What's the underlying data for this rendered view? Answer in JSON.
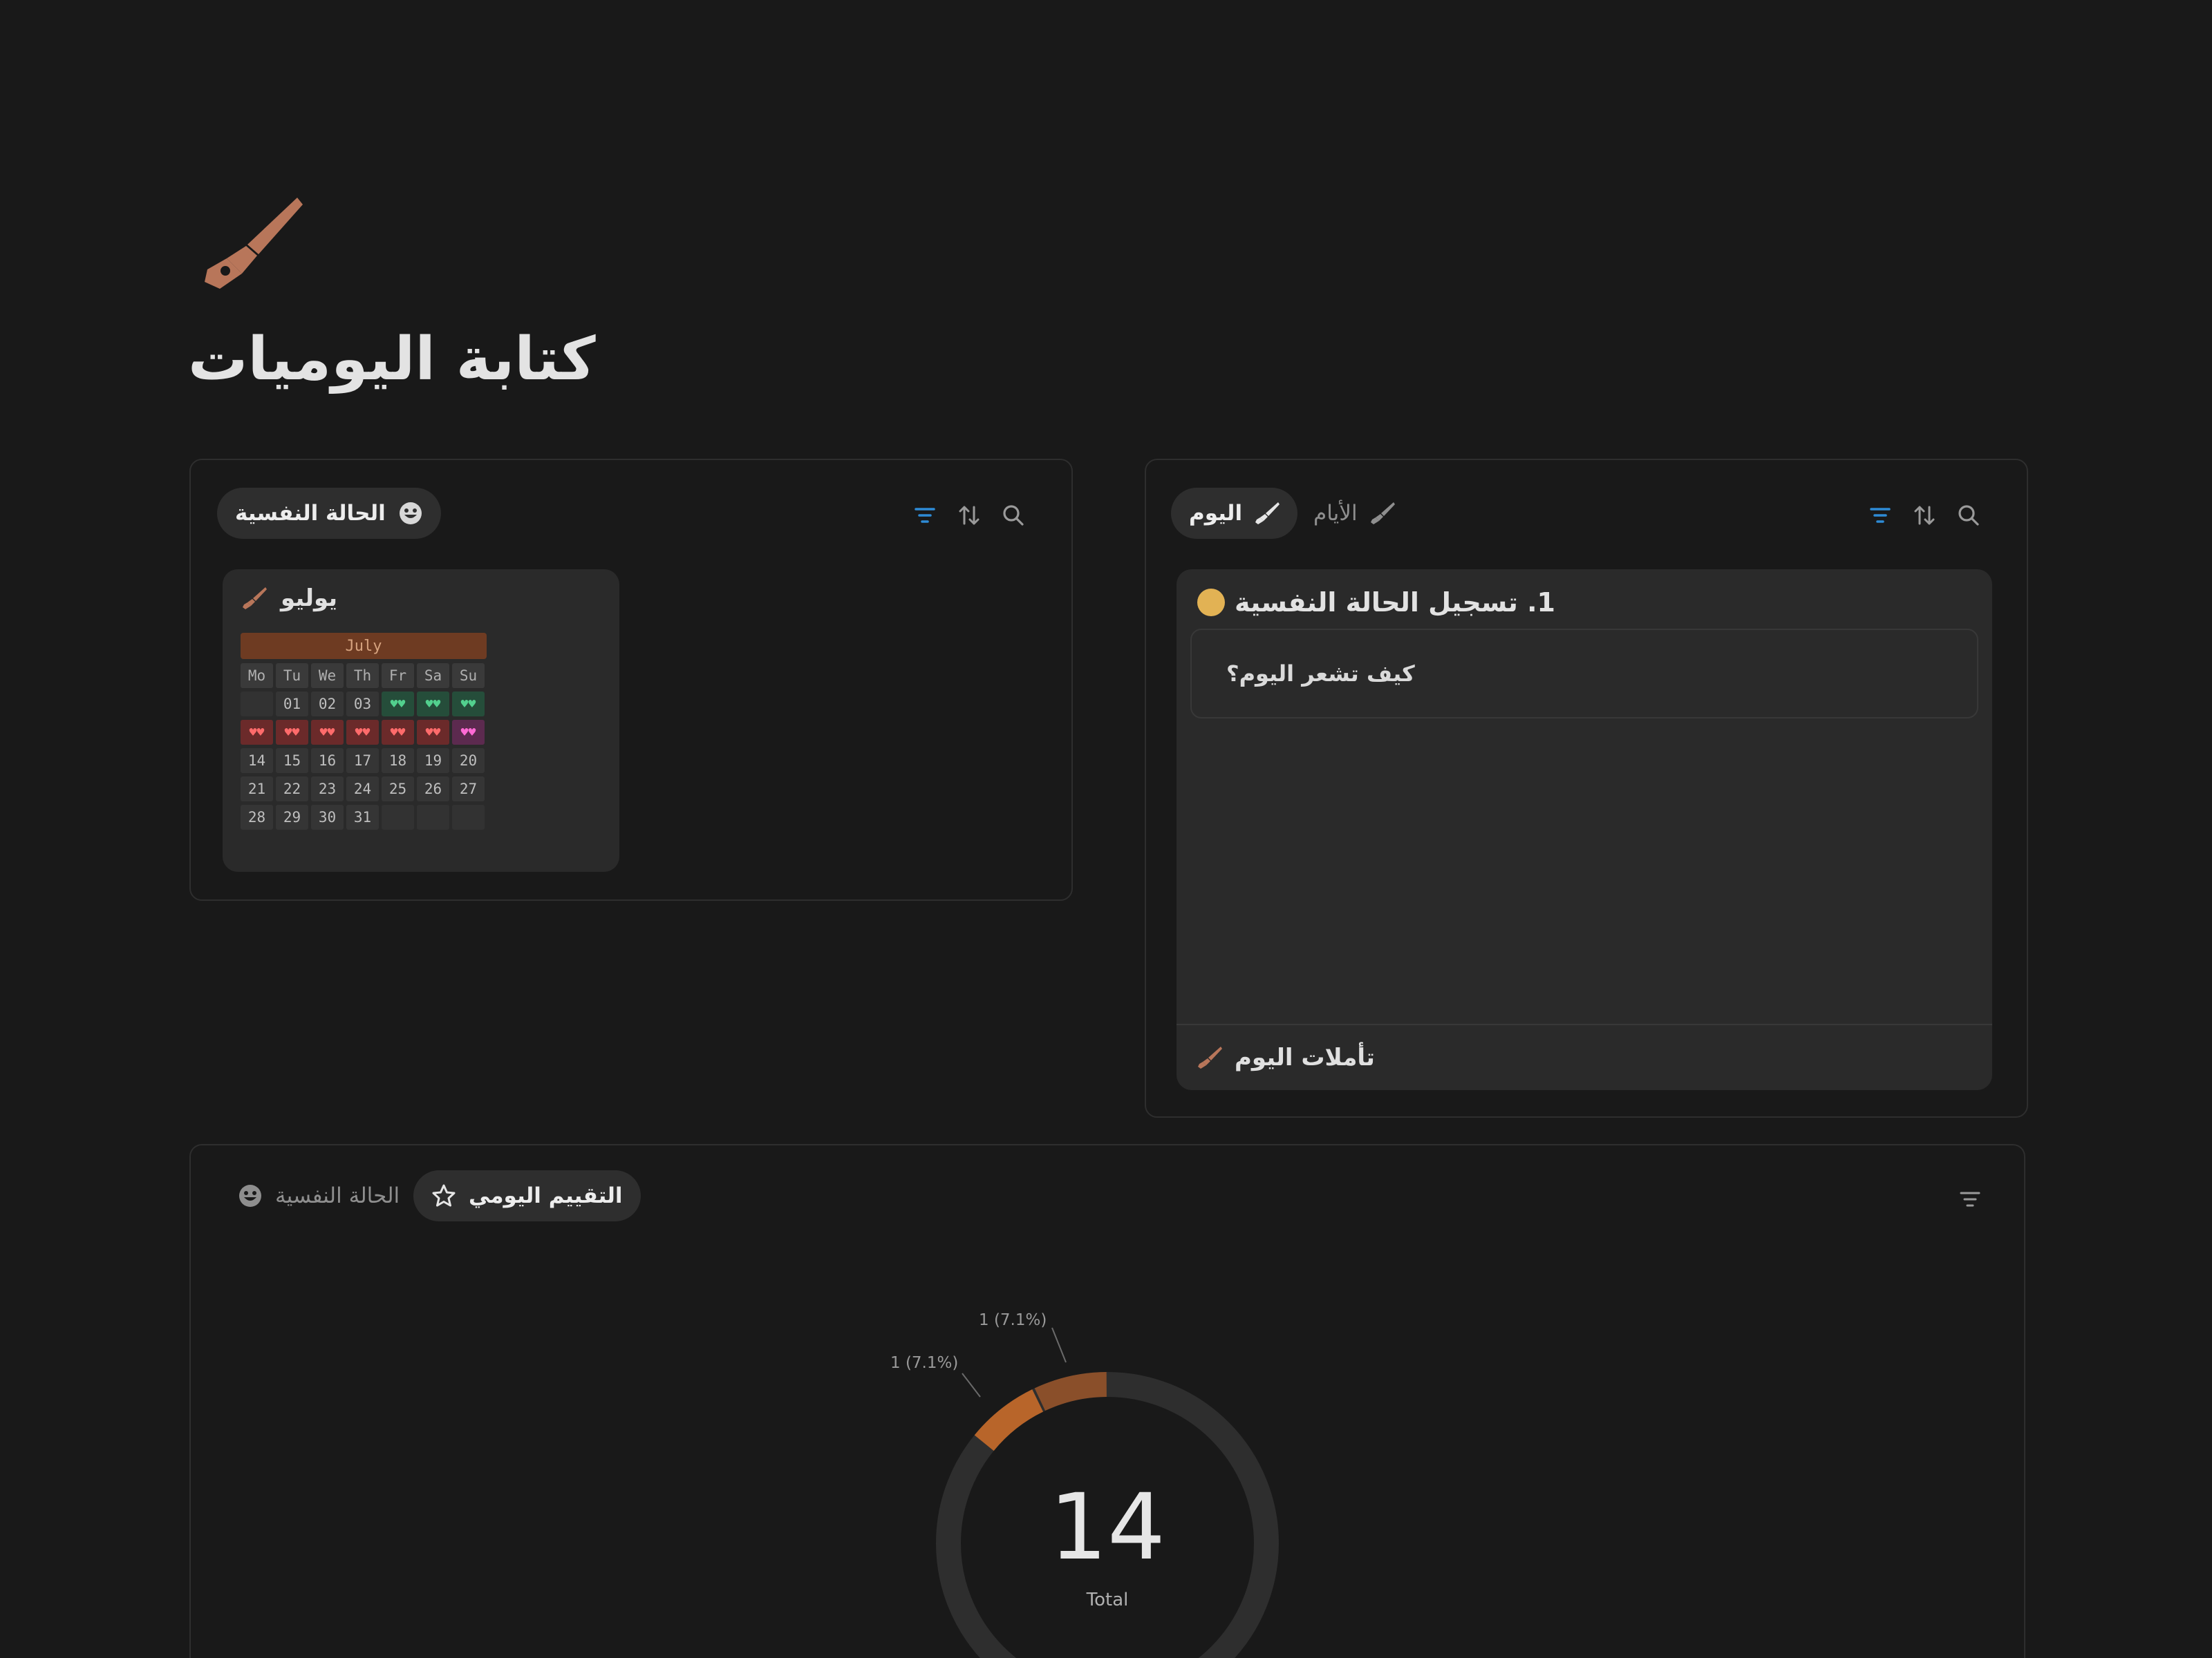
{
  "page": {
    "icon": "fountain-pen-icon",
    "title": "كتابة اليوميات"
  },
  "colors": {
    "background": "#191919",
    "accent_pen": "#b8765a",
    "filter_blue": "#2e8bd6",
    "donut_track": "#2e2e2e",
    "donut_orange": "#b8652a",
    "donut_brown": "#8a4f2a"
  },
  "left_panel": {
    "tab": {
      "label": "الحالة النفسية",
      "icon": "smiley-face-icon"
    },
    "toolbar": [
      "filter-icon",
      "sort-icon",
      "search-icon"
    ],
    "card": {
      "title": "يوليو",
      "icon": "fountain-pen-icon",
      "calendar": {
        "month": "July",
        "weekdays": [
          "Mo",
          "Tu",
          "We",
          "Th",
          "Fr",
          "Sa",
          "Su"
        ],
        "heart": "♥♥",
        "rows": [
          [
            {
              "t": "",
              "k": "empty"
            },
            {
              "t": "01",
              "k": "day"
            },
            {
              "t": "02",
              "k": "day"
            },
            {
              "t": "03",
              "k": "day"
            },
            {
              "t": "♥♥",
              "k": "green"
            },
            {
              "t": "♥♥",
              "k": "green"
            },
            {
              "t": "♥♥",
              "k": "green"
            }
          ],
          [
            {
              "t": "♥♥",
              "k": "red"
            },
            {
              "t": "♥♥",
              "k": "red"
            },
            {
              "t": "♥♥",
              "k": "red"
            },
            {
              "t": "♥♥",
              "k": "red"
            },
            {
              "t": "♥♥",
              "k": "red"
            },
            {
              "t": "♥♥",
              "k": "red"
            },
            {
              "t": "♥♥",
              "k": "pink"
            }
          ],
          [
            {
              "t": "14",
              "k": "day"
            },
            {
              "t": "15",
              "k": "day"
            },
            {
              "t": "16",
              "k": "day"
            },
            {
              "t": "17",
              "k": "day"
            },
            {
              "t": "18",
              "k": "day"
            },
            {
              "t": "19",
              "k": "day"
            },
            {
              "t": "20",
              "k": "day"
            }
          ],
          [
            {
              "t": "21",
              "k": "day"
            },
            {
              "t": "22",
              "k": "day"
            },
            {
              "t": "23",
              "k": "day"
            },
            {
              "t": "24",
              "k": "day"
            },
            {
              "t": "25",
              "k": "day"
            },
            {
              "t": "26",
              "k": "day"
            },
            {
              "t": "27",
              "k": "day"
            }
          ],
          [
            {
              "t": "28",
              "k": "day"
            },
            {
              "t": "29",
              "k": "day"
            },
            {
              "t": "30",
              "k": "day"
            },
            {
              "t": "31",
              "k": "day"
            },
            {
              "t": "",
              "k": "empty"
            },
            {
              "t": "",
              "k": "empty"
            },
            {
              "t": "",
              "k": "empty"
            }
          ]
        ]
      }
    }
  },
  "right_panel": {
    "tabs": [
      {
        "label": "اليوم",
        "icon": "fountain-pen-icon",
        "active": true
      },
      {
        "label": "الأيام",
        "icon": "fountain-pen-icon",
        "active": false
      }
    ],
    "toolbar": [
      "filter-icon",
      "sort-icon",
      "search-icon"
    ],
    "card": {
      "title": "1. تسجيل الحالة النفسية",
      "question": "كيف تشعر اليوم؟",
      "footer": "تأملات اليوم"
    }
  },
  "bottom_panel": {
    "tabs": [
      {
        "label": "التقييم اليومي",
        "icon": "star-icon",
        "active": true
      },
      {
        "label": "الحالة النفسية",
        "icon": "smiley-face-icon",
        "active": false
      }
    ],
    "toolbar": [
      "filter-icon"
    ],
    "chart_data": {
      "type": "pie",
      "style": "donut",
      "center_value": "14",
      "center_label": "Total",
      "total": 14,
      "slices": [
        {
          "value": 1,
          "percent": 7.1,
          "label": "1 (7.1%)",
          "color": "#8a4f2a"
        },
        {
          "value": 1,
          "percent": 7.1,
          "label": "1 (7.1%)",
          "color": "#b8652a"
        },
        {
          "value": 12,
          "percent": 85.7,
          "label": "",
          "color": "#2e2e2e"
        }
      ]
    }
  }
}
